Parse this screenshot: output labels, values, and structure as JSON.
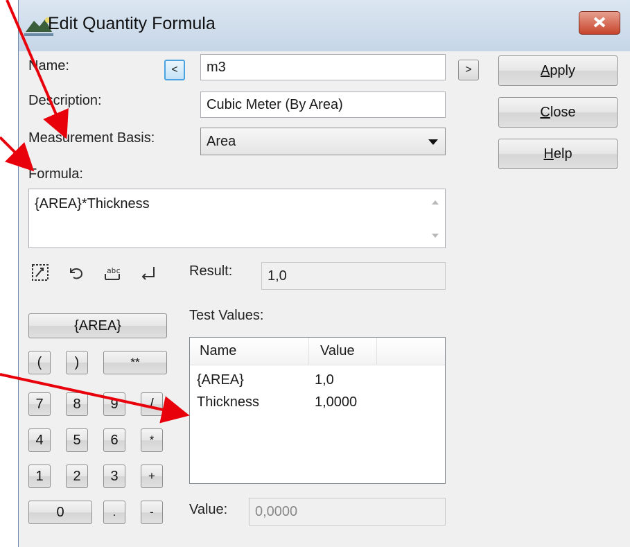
{
  "window": {
    "title": "Edit Quantity Formula"
  },
  "fields": {
    "name_label": "Name:",
    "name_value": "m3",
    "prev_label": "<",
    "next_label": ">",
    "description_label": "Description:",
    "description_value": "Cubic Meter (By Area)",
    "measurement_basis_label": "Measurement Basis:",
    "measurement_basis_value": "Area",
    "formula_label": "Formula:",
    "formula_value": "{AREA}*Thickness",
    "result_label": "Result:",
    "result_value": "1,0",
    "value_label": "Value:",
    "value_value": "0,0000"
  },
  "actions": {
    "apply_prefix": "A",
    "apply_rest": "pply",
    "close_prefix": "C",
    "close_rest": "lose",
    "help_prefix": "H",
    "help_rest": "elp"
  },
  "toolbar_icons": [
    "select-variable-icon",
    "undo-icon",
    "edit-variables-icon",
    "enter-icon"
  ],
  "keypad": {
    "area_button": "{AREA}",
    "open_paren": "(",
    "close_paren": ")",
    "power": "**",
    "k7": "7",
    "k8": "8",
    "k9": "9",
    "divide": "/",
    "k4": "4",
    "k5": "5",
    "k6": "6",
    "multiply": "*",
    "k1": "1",
    "k2": "2",
    "k3": "3",
    "plus": "+",
    "k0": "0",
    "dot": ".",
    "minus": "-"
  },
  "test_values": {
    "label": "Test Values:",
    "columns": [
      "Name",
      "Value"
    ],
    "rows": [
      {
        "name": "{AREA}",
        "value": "1,0"
      },
      {
        "name": "Thickness",
        "value": "1,0000"
      }
    ]
  },
  "colors": {
    "annotation_arrow": "#e8000b",
    "close_button": "#c7442c",
    "focus_border": "#4aa3df"
  }
}
